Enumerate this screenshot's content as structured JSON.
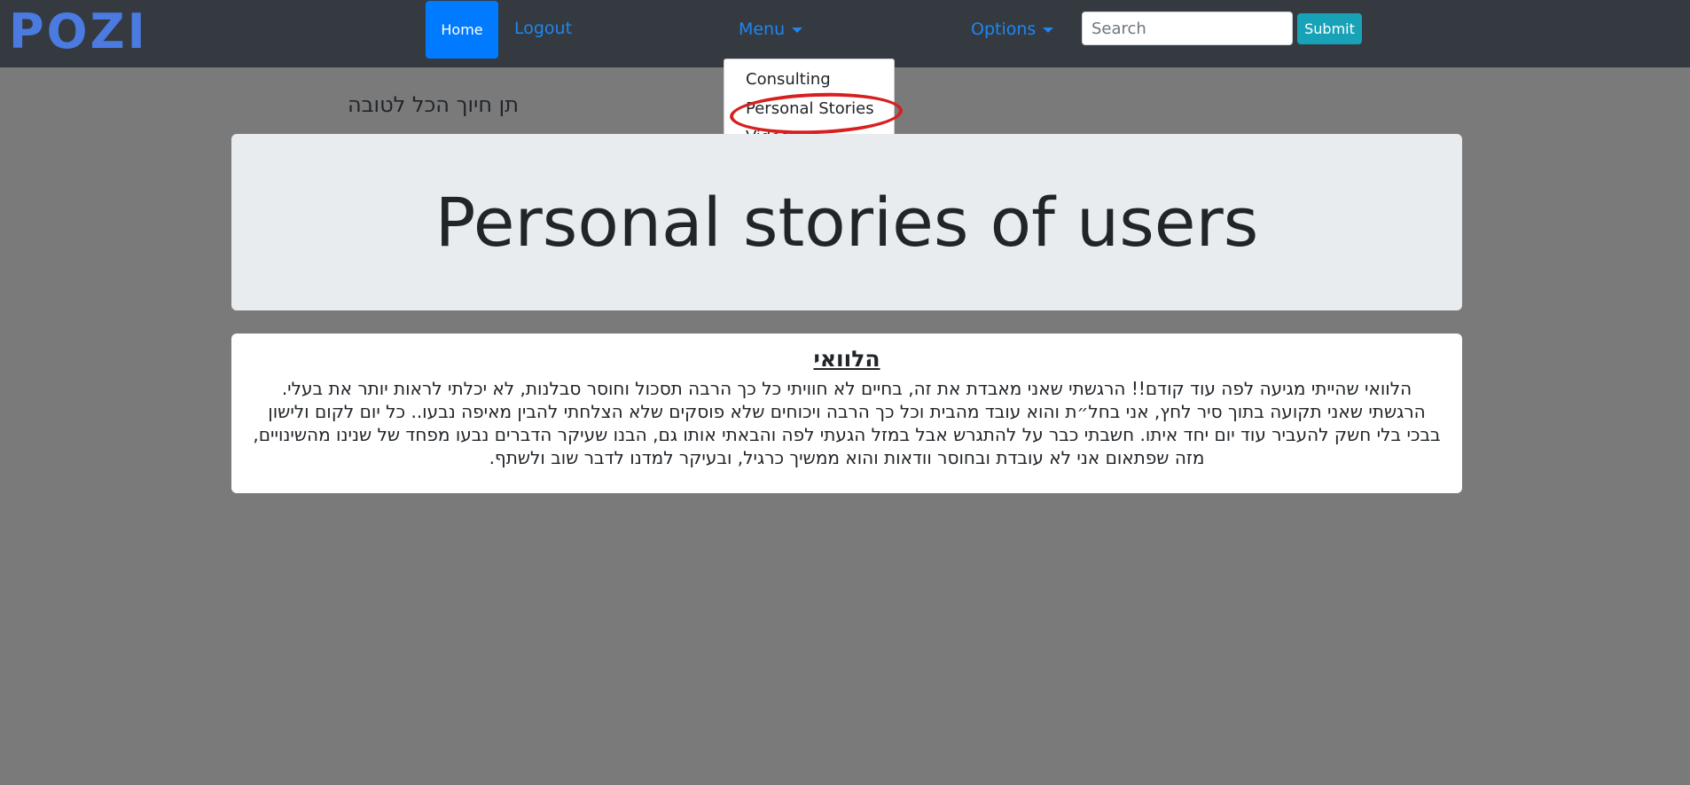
{
  "navbar": {
    "logo": "POZI",
    "home_label": "Home",
    "logout_label": "Logout",
    "menu_label": "Menu",
    "options_label": "Options",
    "search_placeholder": "Search",
    "submit_label": "Submit"
  },
  "menu_dropdown": {
    "items": [
      "Consulting",
      "Personal Stories",
      "Videos"
    ],
    "highlighted_item": "Personal Stories",
    "annotation_color": "#d81f1f"
  },
  "page": {
    "top_phrase": "תן חיוך הכל לטובה",
    "jumbotron_title": "Personal stories of users"
  },
  "story": {
    "title": "הלוואי",
    "body": "הלוואי שהייתי מגיעה לפה עוד קודם!! הרגשתי שאני מאבדת את זה, בחיים לא חוויתי כל כך הרבה תסכול וחוסר סבלנות, לא יכלתי לראות יותר את בעלי. הרגשתי שאני תקועה בתוך סיר לחץ, אני בחל״ת והוא עובד מהבית וכל כך הרבה ויכוחים שלא פוסקים שלא הצלחתי להבין מאיפה נבעו.. כל יום לקום ולישון בבכי בלי חשק להעביר עוד יום יחד איתו. חשבתי כבר על להתגרש אבל במזל הגעתי לפה והבאתי אותו גם, הבנו שעיקר הדברים נבעו מפחד של שנינו מהשינויים, מזה שפתאום אני לא עובדת ובחוסר וודאות והוא ממשיך כרגיל, ובעיקר למדנו לדבר שוב ולשתף."
  },
  "colors": {
    "navbar_bg": "#343a40",
    "page_bg": "#7a7a7a",
    "primary": "#007bff",
    "info": "#17a2b8",
    "logo": "#4b7be0"
  }
}
